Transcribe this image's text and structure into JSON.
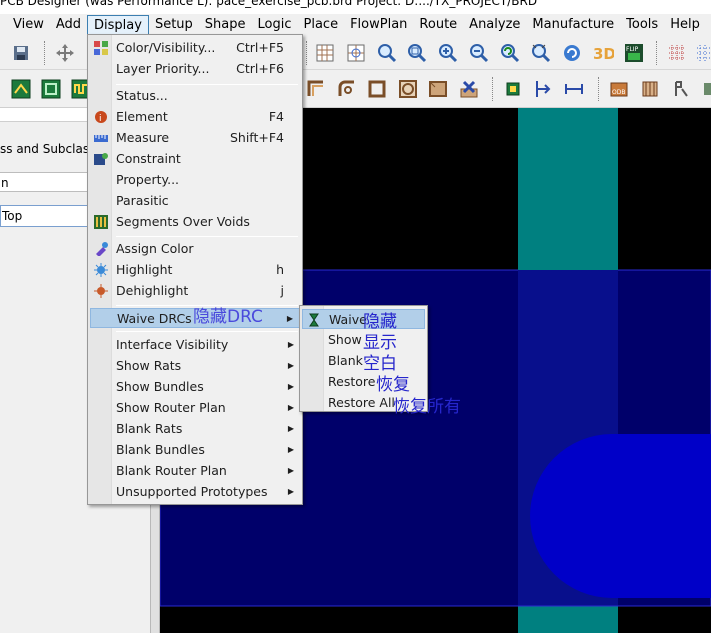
{
  "window": {
    "title": "PCB Designer (was Performance L): pace_exercise_pcb.brd  Project: D:.../TX_PROJECT/BRD"
  },
  "menubar": {
    "items": [
      {
        "label": "View",
        "u": "V"
      },
      {
        "label": "Add",
        "u": "A"
      },
      {
        "label": "Display",
        "u": "D"
      },
      {
        "label": "Setup",
        "u": "S"
      },
      {
        "label": "Shape",
        "u": "S"
      },
      {
        "label": "Logic",
        "u": "L"
      },
      {
        "label": "Place",
        "u": "P"
      },
      {
        "label": "FlowPlan",
        "u": "F"
      },
      {
        "label": "Route",
        "u": "R"
      },
      {
        "label": "Analyze",
        "u": "A"
      },
      {
        "label": "Manufacture",
        "u": "M"
      },
      {
        "label": "Tools",
        "u": "T"
      },
      {
        "label": "Help",
        "u": "H"
      }
    ]
  },
  "left_panel": {
    "heading": "ss and Subclass:",
    "row1": "n",
    "value": "Top"
  },
  "display_menu": {
    "items": [
      {
        "label": "Color/Visibility...",
        "shortcut": "Ctrl+F5"
      },
      {
        "label": "Layer Priority...",
        "shortcut": "Ctrl+F6"
      },
      {
        "label": "Status...",
        "shortcut": ""
      },
      {
        "label": "Element",
        "shortcut": "F4"
      },
      {
        "label": "Measure",
        "shortcut": "Shift+F4"
      },
      {
        "label": "Constraint",
        "shortcut": ""
      },
      {
        "label": "Property...",
        "shortcut": ""
      },
      {
        "label": "Parasitic",
        "shortcut": ""
      },
      {
        "label": "Segments Over Voids",
        "shortcut": ""
      },
      {
        "label": "Assign Color",
        "shortcut": ""
      },
      {
        "label": "Highlight",
        "shortcut": "h"
      },
      {
        "label": "Dehighlight",
        "shortcut": "j"
      },
      {
        "label": "Waive DRCs",
        "shortcut": ""
      },
      {
        "label": "Interface Visibility",
        "shortcut": ""
      },
      {
        "label": "Show Rats",
        "shortcut": ""
      },
      {
        "label": "Show Bundles",
        "shortcut": ""
      },
      {
        "label": "Show Router Plan",
        "shortcut": ""
      },
      {
        "label": "Blank Rats",
        "shortcut": ""
      },
      {
        "label": "Blank Bundles",
        "shortcut": ""
      },
      {
        "label": "Blank Router Plan",
        "shortcut": ""
      },
      {
        "label": "Unsupported Prototypes",
        "shortcut": ""
      }
    ]
  },
  "waive_submenu": {
    "items": [
      {
        "label": "Waive",
        "note": "隐藏"
      },
      {
        "label": "Show",
        "note": "显示"
      },
      {
        "label": "Blank",
        "note": "空白"
      },
      {
        "label": "Restore",
        "note": "恢复"
      },
      {
        "label": "Restore All",
        "note": "恢复所有"
      }
    ]
  },
  "annotations": {
    "waive_drcs": "隐藏DRC"
  },
  "colors": {
    "canvas_bg": "#000000",
    "board_blue": "#00006a",
    "teal": "#008080",
    "pad_blue": "#0000c8",
    "highlight": "#b2cfe9"
  }
}
